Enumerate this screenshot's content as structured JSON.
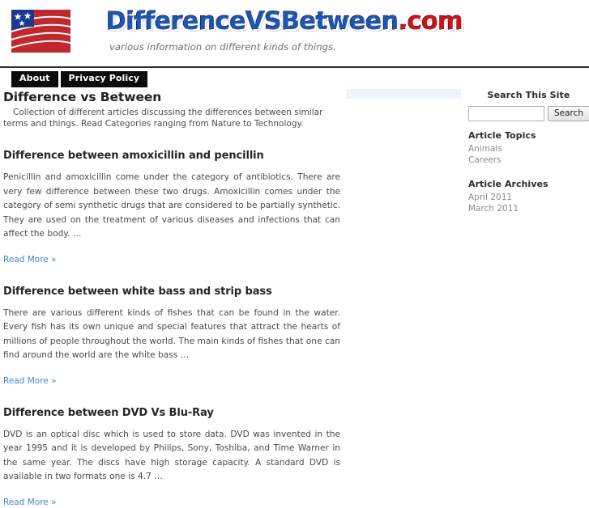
{
  "header": {
    "logo_icon": "us-flag-icon",
    "brand_blue": "DifferenceVSBetween",
    "brand_red": ".com",
    "tagline": "various information on different kinds of things.",
    "brand_blue_color": "#1d56b2",
    "brand_red_color": "#cc1417"
  },
  "nav": {
    "items": [
      {
        "label": "About"
      },
      {
        "label": "Privacy Policy"
      }
    ]
  },
  "main": {
    "site_heading": "Difference vs Between",
    "site_description": "Collection of different articles discussing the differences between similar terms and things. Read Categories ranging from Nature to Technology.",
    "read_more_label": "Read More »",
    "read_more_color": "#4a86c8",
    "articles": [
      {
        "title": "Difference between amoxicillin and pencillin",
        "body": "Penicillin and amoxicillin come under the category of antibiotics. There are very few difference between these two drugs. Amoxicillin comes under the category of semi synthetic drugs that are considered to be partially synthetic. They are used on the treatment of various diseases and infections that can affect the body. …"
      },
      {
        "title": "Difference between white bass and strip bass",
        "body": "There are various different kinds of fishes that can be found in the water. Every fish has its own unique and special features that attract the hearts of millions of people throughout the world. The main kinds of fishes that one can find around the world are the white bass …"
      },
      {
        "title": "Difference between DVD Vs Blu-Ray",
        "body": "DVD is an optical disc which is used to store data. DVD was invented in the year 1995 and it is developed by Philips, Sony, Toshiba, and Time Warner in the same year. The discs have high storage capacity. A standard DVD is available in two formats one is 4.7 …"
      }
    ]
  },
  "sidebar": {
    "search_title": "Search This Site",
    "search_value": "",
    "search_placeholder": "",
    "search_button_label": "Search",
    "topics_title": "Article Topics",
    "topics": [
      {
        "label": "Animals"
      },
      {
        "label": "Careers"
      }
    ],
    "archives_title": "Article Archives",
    "archives": [
      {
        "label": "April 2011"
      },
      {
        "label": "March 2011"
      }
    ]
  }
}
